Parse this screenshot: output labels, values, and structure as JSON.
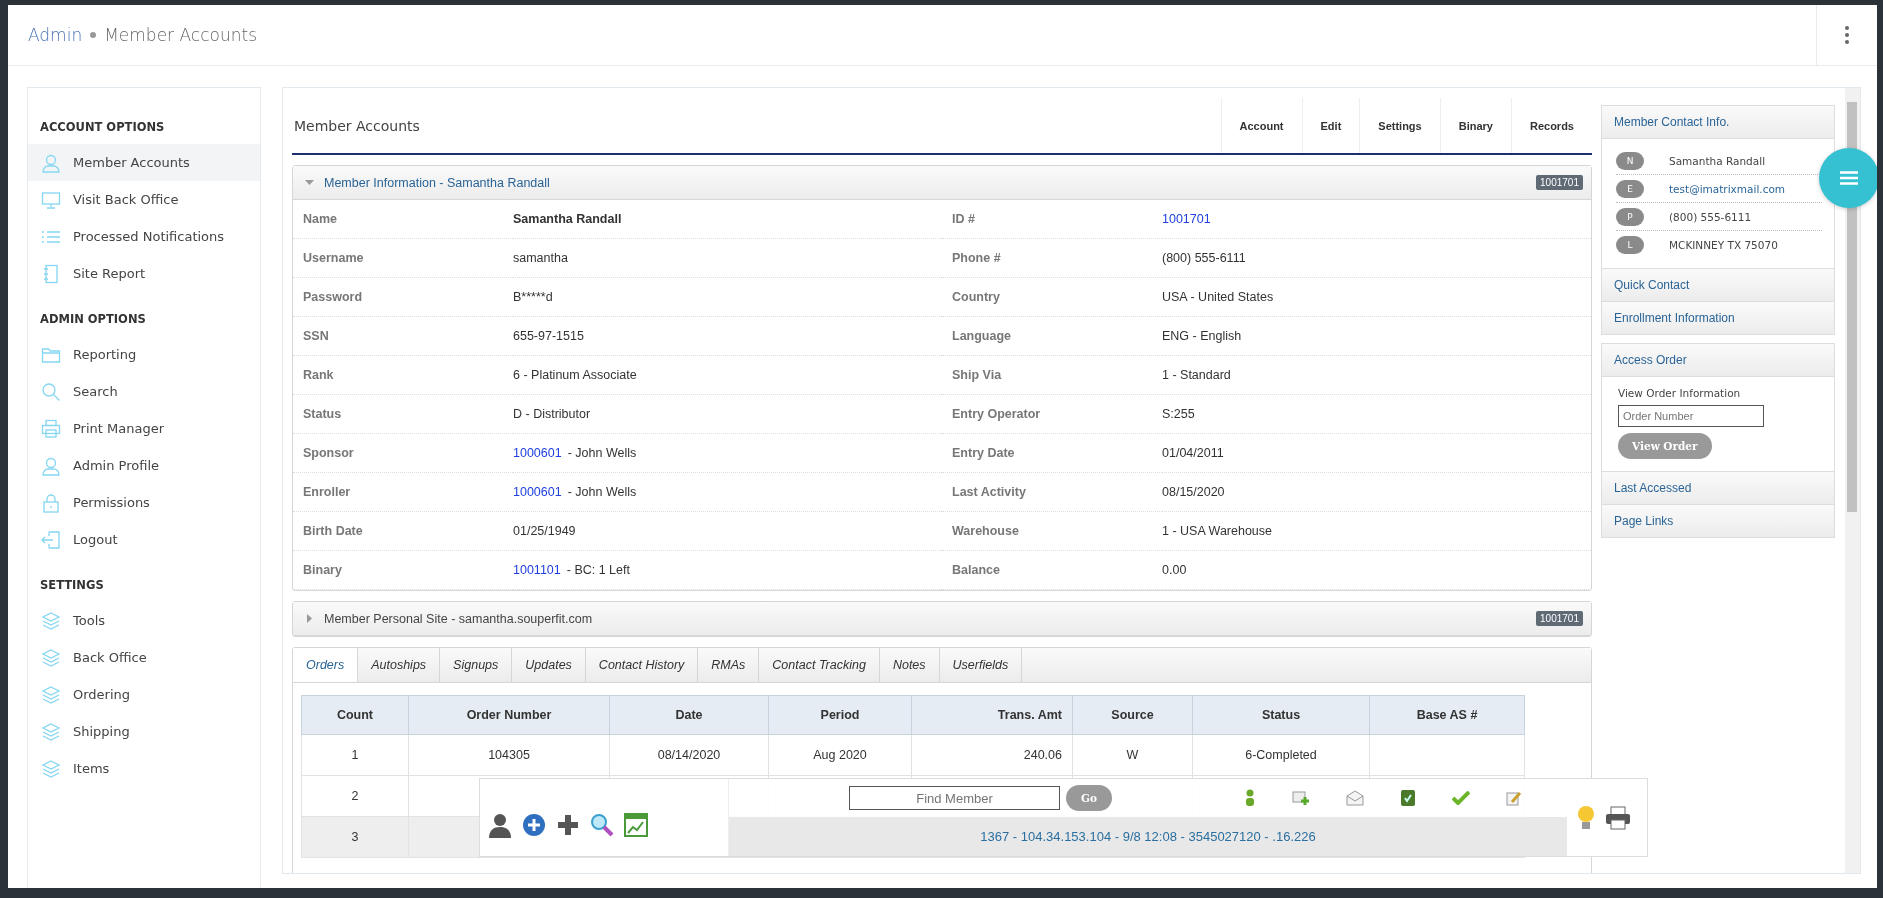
{
  "header": {
    "breadcrumb": [
      {
        "label": "Admin"
      },
      {
        "label": "Member Accounts"
      }
    ]
  },
  "sidebar": {
    "sections": [
      {
        "title": "ACCOUNT OPTIONS",
        "items": [
          {
            "label": "Member Accounts",
            "kind": "user",
            "selected": true
          },
          {
            "label": "Visit Back Office",
            "kind": "monitor",
            "selected": false
          },
          {
            "label": "Processed Notifications",
            "kind": "list",
            "selected": false
          },
          {
            "label": "Site Report",
            "kind": "book",
            "selected": false
          }
        ]
      },
      {
        "title": "ADMIN OPTIONS",
        "items": [
          {
            "label": "Reporting",
            "kind": "folder",
            "selected": false
          },
          {
            "label": "Search",
            "kind": "search",
            "selected": false
          },
          {
            "label": "Print Manager",
            "kind": "printer",
            "selected": false
          },
          {
            "label": "Admin Profile",
            "kind": "user",
            "selected": false
          },
          {
            "label": "Permissions",
            "kind": "lock",
            "selected": false
          },
          {
            "label": "Logout",
            "kind": "logout",
            "selected": false
          }
        ]
      },
      {
        "title": "SETTINGS",
        "items": [
          {
            "label": "Tools",
            "kind": "layers",
            "selected": false
          },
          {
            "label": "Back Office",
            "kind": "layers",
            "selected": false
          },
          {
            "label": "Ordering",
            "kind": "layers",
            "selected": false
          },
          {
            "label": "Shipping",
            "kind": "layers",
            "selected": false
          },
          {
            "label": "Items",
            "kind": "layers",
            "selected": false
          }
        ]
      }
    ]
  },
  "main": {
    "title": "Member Accounts",
    "actions": [
      "Account",
      "Edit",
      "Settings",
      "Binary",
      "Records"
    ]
  },
  "member_info": {
    "title": "Member Information - Samantha Randall",
    "badge": "1001701",
    "expanded": true,
    "left": [
      {
        "label": "Name",
        "kind": "strong",
        "value": "Samantha Randall"
      },
      {
        "label": "Username",
        "kind": "plain",
        "value": "samantha"
      },
      {
        "label": "Password",
        "kind": "plain",
        "value": "B*****d"
      },
      {
        "label": "SSN",
        "kind": "plain",
        "value": "655-97-1515"
      },
      {
        "label": "Rank",
        "kind": "plain",
        "value": "6 - Platinum Associate"
      },
      {
        "label": "Status",
        "kind": "plain",
        "value": "D - Distributor"
      },
      {
        "label": "Sponsor",
        "kind": "link",
        "link": "1000601",
        "value": "- John Wells"
      },
      {
        "label": "Enroller",
        "kind": "link",
        "link": "1000601",
        "value": "- John Wells"
      },
      {
        "label": "Birth Date",
        "kind": "plain",
        "value": "01/25/1949"
      },
      {
        "label": "Binary",
        "kind": "link",
        "link": "1001101",
        "value": "- BC: 1 Left"
      }
    ],
    "right": [
      {
        "label": "ID #",
        "kind": "link",
        "link": "1001701"
      },
      {
        "label": "Phone #",
        "kind": "plain",
        "value": "(800) 555-6111"
      },
      {
        "label": "Country",
        "kind": "plain",
        "value": "USA - United States"
      },
      {
        "label": "Language",
        "kind": "plain",
        "value": "ENG - English"
      },
      {
        "label": "Ship Via",
        "kind": "plain",
        "value": "1 - Standard"
      },
      {
        "label": "Entry Operator",
        "kind": "plain",
        "value": "S:255"
      },
      {
        "label": "Entry Date",
        "kind": "plain",
        "value": "01/04/2011"
      },
      {
        "label": "Last Activity",
        "kind": "plain",
        "value": "08/15/2020"
      },
      {
        "label": "Warehouse",
        "kind": "plain",
        "value": "1 - USA Warehouse"
      },
      {
        "label": "Balance",
        "kind": "plain",
        "value": "0.00"
      }
    ]
  },
  "personal_site": {
    "title": "Member Personal Site - samantha.souperfit.com",
    "badge": "1001701",
    "expanded": false
  },
  "order_tabs": [
    {
      "label": "Orders",
      "selected": true
    },
    {
      "label": "Autoships",
      "selected": false
    },
    {
      "label": "Signups",
      "selected": false
    },
    {
      "label": "Updates",
      "selected": false
    },
    {
      "label": "Contact History",
      "selected": false
    },
    {
      "label": "RMAs",
      "selected": false
    },
    {
      "label": "Contact Tracking",
      "selected": false
    },
    {
      "label": "Notes",
      "selected": false
    },
    {
      "label": "Userfields",
      "selected": false
    }
  ],
  "orders": {
    "columns": [
      "Count",
      "Order Number",
      "Date",
      "Period",
      "Trans. Amt",
      "Source",
      "Status",
      "Base AS #"
    ],
    "rows": [
      {
        "cells": [
          "1",
          "104305",
          "08/14/2020",
          "Aug 2020",
          "240.06",
          "W",
          "6-Completed"
        ]
      },
      {
        "cells": [
          "2"
        ]
      },
      {
        "cells": [
          "3"
        ]
      }
    ]
  },
  "toolbar": {
    "find_placeholder": "Find Member",
    "go": "Go",
    "status": "1367 - 104.34.153.104 - 9/8 12:08 - 3545027120 - .16.226"
  },
  "contact": {
    "title": "Member Contact Info.",
    "entries": [
      {
        "letter": "N",
        "kind": "text",
        "value": "Samantha Randall"
      },
      {
        "letter": "E",
        "kind": "link",
        "value": "test@imatrixmail.com"
      },
      {
        "letter": "P",
        "kind": "text",
        "value": "(800) 555-6111"
      },
      {
        "letter": "L",
        "kind": "text",
        "value": "MCKINNEY TX 75070"
      }
    ],
    "sections": [
      "Quick Contact",
      "Enrollment Information"
    ]
  },
  "access_order": {
    "title": "Access Order",
    "label": "View Order Information",
    "placeholder": "Order Number",
    "button": "View Order",
    "sections": [
      "Last Accessed",
      "Page Links"
    ]
  }
}
